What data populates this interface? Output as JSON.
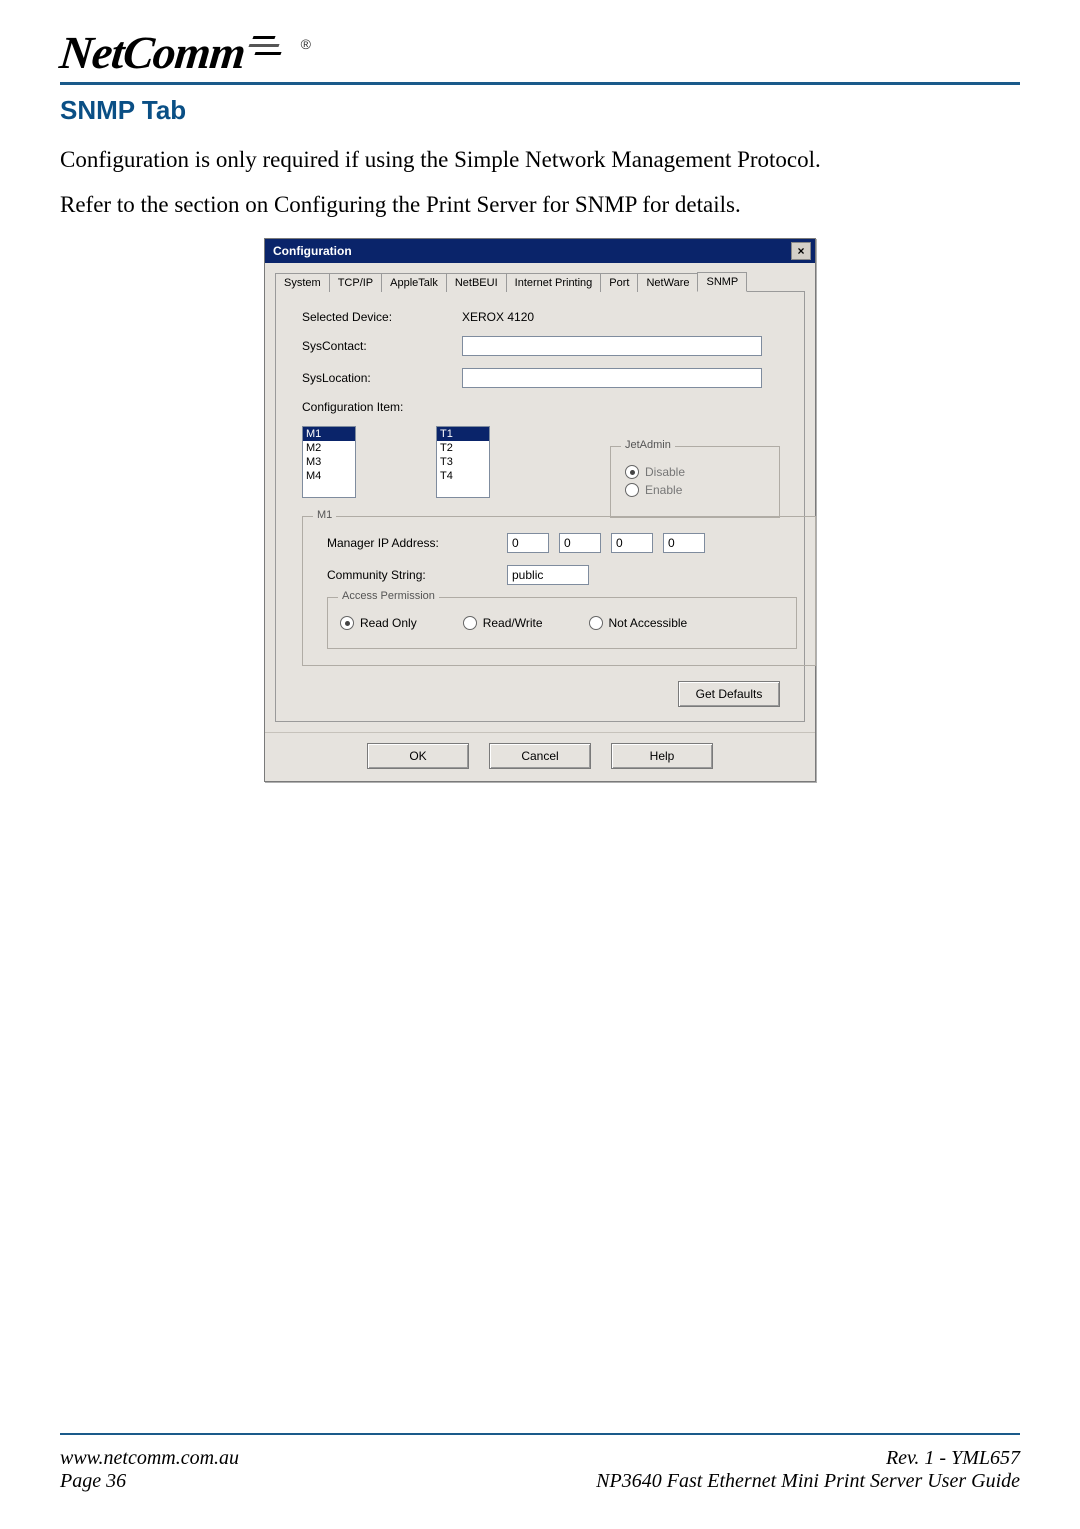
{
  "header": {
    "logo_text": "NetComm",
    "registered": "®"
  },
  "section_title": "SNMP Tab",
  "paragraphs": {
    "p1": "Configuration is only required if using the Simple Network Management Protocol.",
    "p2": "Refer to the section on Configuring the Print Server for SNMP for details."
  },
  "dialog": {
    "title": "Configuration",
    "close_glyph": "×",
    "tabs": {
      "t0": "System",
      "t1": "TCP/IP",
      "t2": "AppleTalk",
      "t3": "NetBEUI",
      "t4": "Internet Printing",
      "t5": "Port",
      "t6": "NetWare",
      "t7": "SNMP"
    },
    "labels": {
      "selected_device": "Selected Device:",
      "sys_contact": "SysContact:",
      "sys_location": "SysLocation:",
      "config_item": "Configuration Item:",
      "jetadmin": "JetAdmin",
      "disable": "Disable",
      "enable": "Enable",
      "m1": "M1",
      "manager_ip": "Manager IP Address:",
      "community_string": "Community String:",
      "access_permission": "Access Permission",
      "read_only": "Read Only",
      "read_write": "Read/Write",
      "not_accessible": "Not Accessible"
    },
    "values": {
      "selected_device": "XEROX 4120",
      "sys_contact": "",
      "sys_location": "",
      "left_list": {
        "i0": "M1",
        "i1": "M2",
        "i2": "M3",
        "i3": "M4"
      },
      "right_list": {
        "i0": "T1",
        "i1": "T2",
        "i2": "T3",
        "i3": "T4"
      },
      "ip0": "0",
      "ip1": "0",
      "ip2": "0",
      "ip3": "0",
      "community_string": "public"
    },
    "buttons": {
      "get_defaults": "Get Defaults",
      "ok": "OK",
      "cancel": "Cancel",
      "help": "Help"
    }
  },
  "footer": {
    "url": "www.netcomm.com.au",
    "page": "Page 36",
    "rev": "Rev. 1 - YML657",
    "guide": "NP3640  Fast Ethernet Mini Print Server User Guide"
  }
}
